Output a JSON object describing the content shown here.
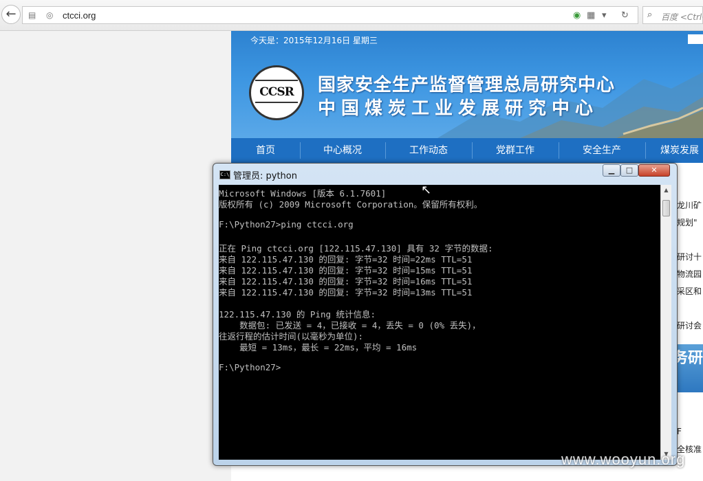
{
  "browser": {
    "url": "ctcci.org",
    "search_placeholder": "百度 <Ctrl+"
  },
  "site": {
    "date_text": "今天是：2015年12月16日 星期三",
    "logo_text": "CCSR",
    "title_line1": "国家安全生产监督管理总局研究中心",
    "title_line2": "中国煤炭工业发展研究中心",
    "nav": [
      "首页",
      "中心概况",
      "工作动态",
      "党群工作",
      "安全生产",
      "煤炭发展"
    ],
    "right_fragments": [
      "龙川矿",
      "规划\"",
      "研讨十",
      "物流园",
      "采区和",
      "研讨会",
      "F",
      "全核准"
    ],
    "ad_text": "务研"
  },
  "cmd": {
    "title": "管理员: python",
    "lines": [
      "Microsoft Windows [版本 6.1.7601]",
      "版权所有 (c) 2009 Microsoft Corporation。保留所有权利。",
      "",
      "F:\\Python27>ping ctcci.org",
      "",
      "正在 Ping ctcci.org [122.115.47.130] 具有 32 字节的数据:",
      "来自 122.115.47.130 的回复: 字节=32 时间=22ms TTL=51",
      "来自 122.115.47.130 的回复: 字节=32 时间=15ms TTL=51",
      "来自 122.115.47.130 的回复: 字节=32 时间=16ms TTL=51",
      "来自 122.115.47.130 的回复: 字节=32 时间=13ms TTL=51",
      "",
      "122.115.47.130 的 Ping 统计信息:",
      "    数据包: 已发送 = 4，已接收 = 4，丢失 = 0 (0% 丢失)，",
      "往返行程的估计时间(以毫秒为单位):",
      "    最短 = 13ms，最长 = 22ms，平均 = 16ms",
      "",
      "F:\\Python27>"
    ]
  },
  "watermark": "www.wooyun.org"
}
